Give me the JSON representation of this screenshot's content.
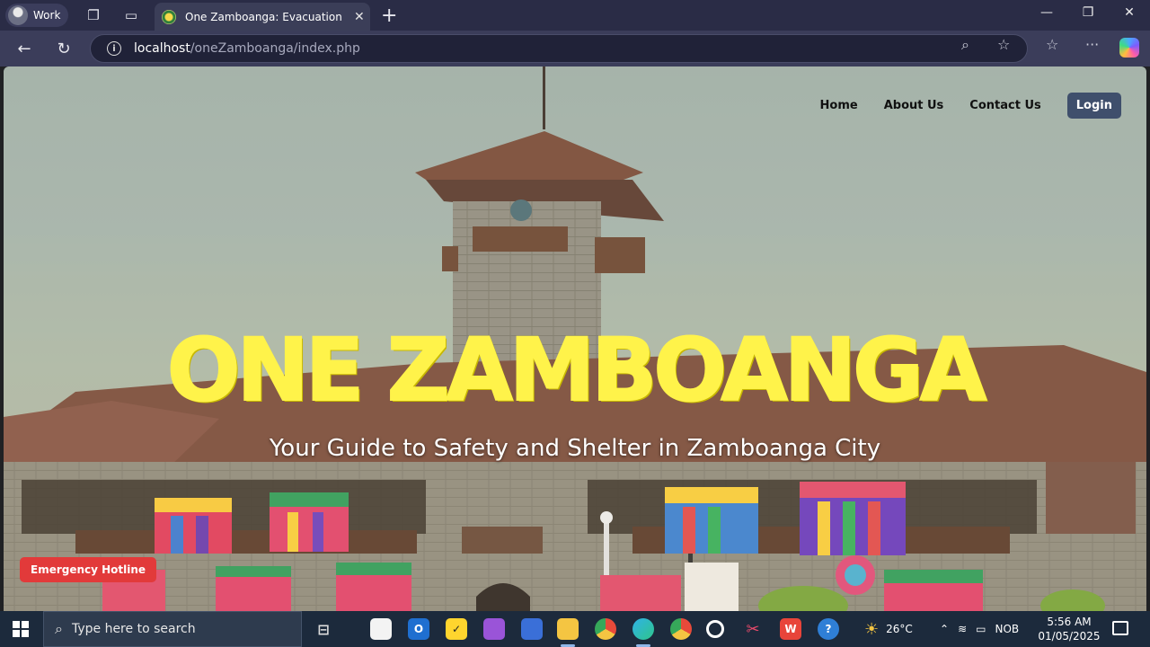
{
  "browser": {
    "profile_label": "Work",
    "tab_title": "One Zamboanga: Evacuation Cent",
    "url_host": "localhost",
    "url_path": "/oneZamboanga/index.php"
  },
  "page": {
    "nav": {
      "home": "Home",
      "about": "About Us",
      "contact": "Contact Us",
      "login": "Login"
    },
    "hero_title": "ONE ZAMBOANGA",
    "hero_subtitle": "Your Guide to Safety and Shelter in Zamboanga City",
    "emergency_button": "Emergency Hotline",
    "colors": {
      "title_yellow": "#fff34a",
      "login_bg": "#3f4f6c",
      "hotline_bg": "#e23a3a"
    }
  },
  "taskbar": {
    "search_placeholder": "Type here to search",
    "weather": "26°C",
    "language": "NOB",
    "time": "5:56 AM",
    "date": "01/05/2025"
  }
}
